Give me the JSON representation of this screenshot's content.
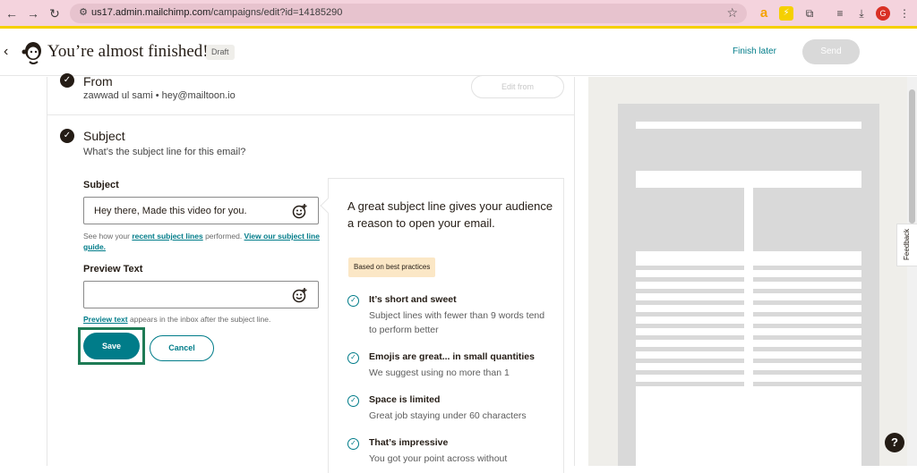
{
  "browser": {
    "url_host": "us17.admin.mailchimp.com",
    "url_path": "/campaigns/edit?id=14185290",
    "icons": [
      "back-arrow-icon",
      "forward-arrow-icon",
      "reload-icon",
      "site-info-icon",
      "bookmark-star-icon",
      "extension-a-icon",
      "extension-bolt-icon",
      "extensions-puzzle-icon",
      "reading-list-icon",
      "download-icon",
      "profile-avatar-icon",
      "menu-icon"
    ],
    "avatar_letter": "G"
  },
  "header": {
    "title": "You’re almost finished!",
    "badge": "Draft",
    "finish_later": "Finish later",
    "send": "Send"
  },
  "from_section": {
    "title": "From",
    "name": "zawwad ul sami",
    "separator": "•",
    "email": "hey@mailtoon.io",
    "edit_button": "Edit from"
  },
  "subject_section": {
    "title": "Subject",
    "subtitle": "What’s the subject line for this email?",
    "subject_label": "Subject",
    "subject_value": "Hey there, Made this video for you.",
    "help_prefix": "See how your ",
    "help_link1": "recent subject lines",
    "help_middle": " performed. ",
    "help_link2": "View our subject line guide.",
    "preview_label": "Preview Text",
    "preview_value": "",
    "preview_help_link": "Preview text",
    "preview_help_rest": " appears in the inbox after the subject line.",
    "save": "Save",
    "cancel": "Cancel"
  },
  "tips": {
    "heading": "A great subject line gives your audience a reason to open your email.",
    "badge": "Based on best practices",
    "items": [
      {
        "title": "It’s short and sweet",
        "desc": "Subject lines with fewer than 9 words tend to perform better"
      },
      {
        "title": "Emojis are great... in small quantities",
        "desc": "We suggest using no more than 1"
      },
      {
        "title": "Space is limited",
        "desc": "Great job staying under 60 characters"
      },
      {
        "title": "That’s impressive",
        "desc": "You got your point across without"
      }
    ]
  },
  "side": {
    "feedback": "Feedback",
    "help": "?"
  },
  "colors": {
    "accent": "#007c89",
    "browser_bar": "#f4d3dd",
    "focus_outline": "#1e7b55",
    "badge_bg": "#fbe7c6"
  }
}
